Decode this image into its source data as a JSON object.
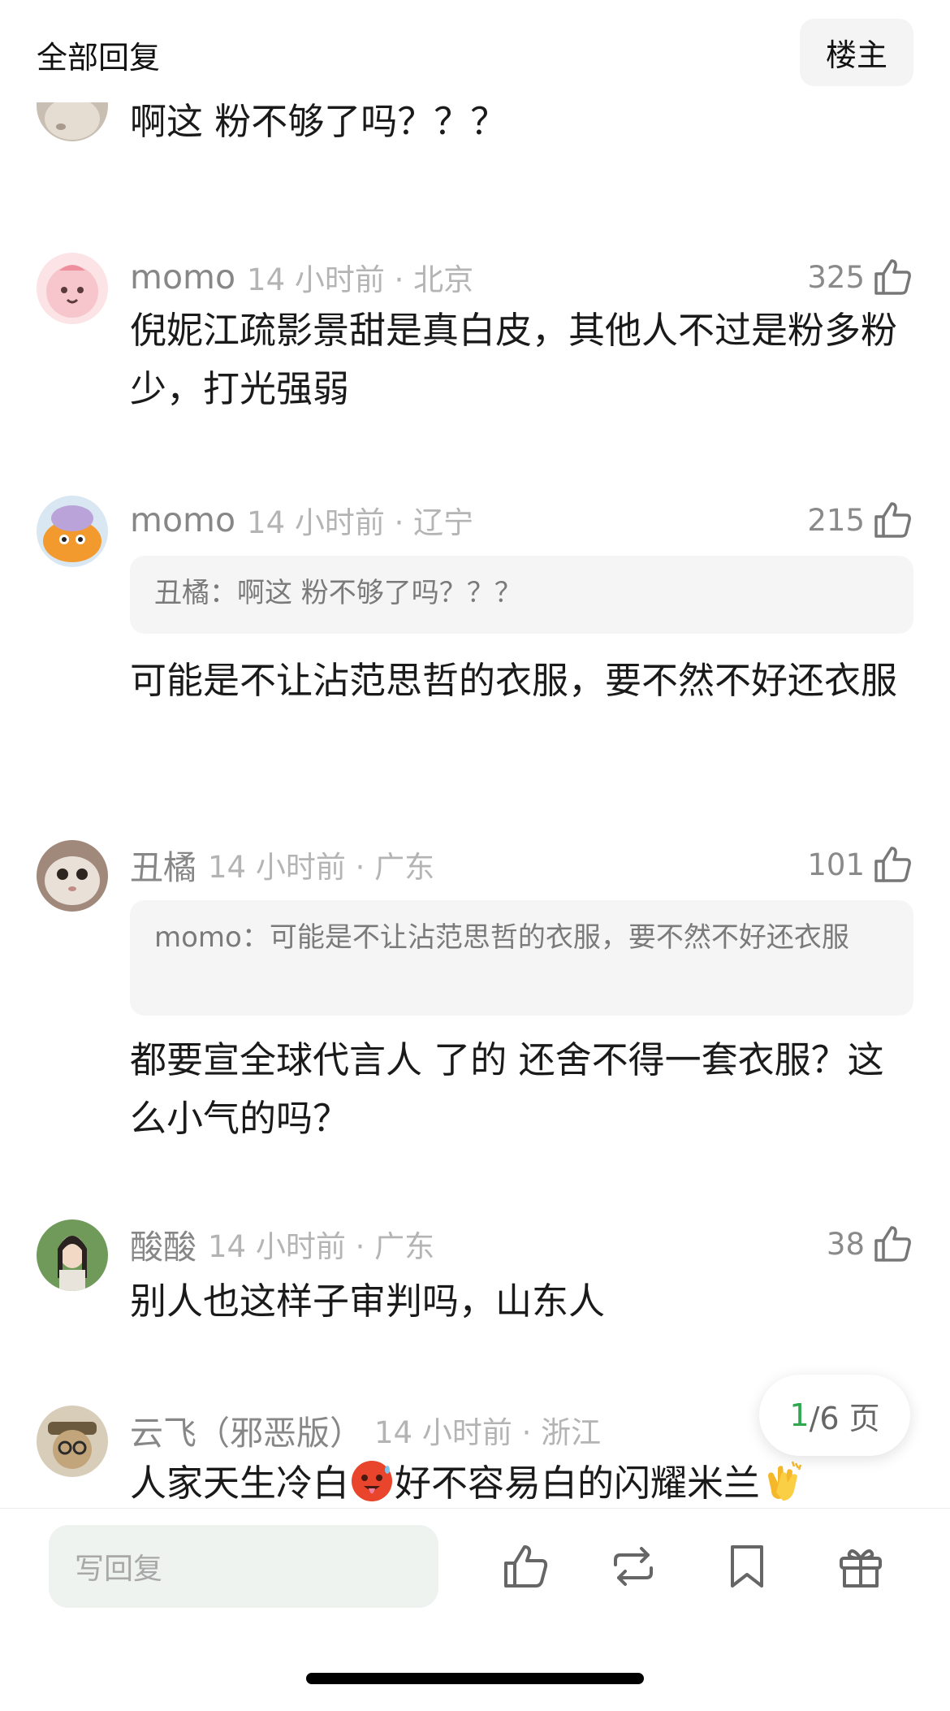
{
  "header": {
    "title": "全部回复",
    "author_button": "楼主"
  },
  "comments": [
    {
      "text": "啊这  粉不够了吗？？？"
    },
    {
      "username": "momo",
      "time_location": "14 小时前 · 北京",
      "likes": "325",
      "text": "倪妮江疏影景甜是真白皮，其他人不过是粉多粉少，打光强弱"
    },
    {
      "username": "momo",
      "time_location": "14 小时前 · 辽宁",
      "likes": "215",
      "quote": "丑橘：啊这  粉不够了吗？？？",
      "text": "可能是不让沾范思哲的衣服，要不然不好还衣服"
    },
    {
      "username": "丑橘",
      "time_location": "14 小时前 · 广东",
      "likes": "101",
      "quote": "momo：可能是不让沾范思哲的衣服，要不然不好还衣服",
      "text": "都要宣全球代言人 了的 还舍不得一套衣服？这么小气的吗？"
    },
    {
      "username": "酸酸",
      "time_location": "14 小时前 · 广东",
      "likes": "38",
      "text": "别人也这样子审判吗，山东人"
    },
    {
      "username": "云飞（邪恶版）",
      "time_location": "14 小时前 · 浙江",
      "text_part1": "人家天生冷白",
      "text_part2": "好不容易白的闪耀米兰",
      "emoji1": "hot-face-emoji",
      "emoji2": "clapping-hands-emoji"
    }
  ],
  "pagination": {
    "current": "1",
    "total": "/6 页"
  },
  "bottom_bar": {
    "reply_placeholder": "写回复",
    "actions": [
      "thumbs-up-icon",
      "repost-icon",
      "bookmark-icon",
      "gift-icon"
    ]
  },
  "colors": {
    "accent": "#2fa84f",
    "meta_text": "#b4b4b4",
    "quote_bg": "#f5f5f5"
  }
}
